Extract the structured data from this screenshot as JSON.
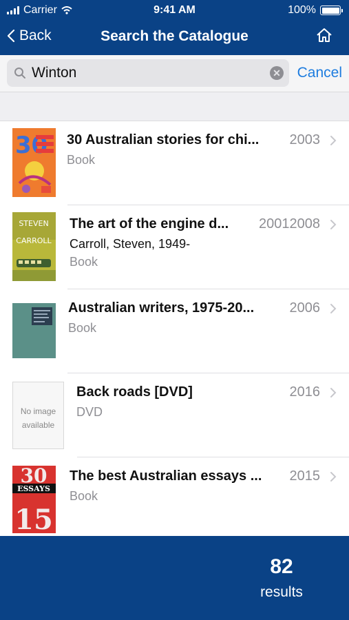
{
  "status_bar": {
    "carrier": "Carrier",
    "time": "9:41 AM",
    "battery": "100%",
    "battery_level": 1.0
  },
  "nav": {
    "back_label": "Back",
    "title": "Search the Catalogue",
    "home_icon": "home-icon"
  },
  "search": {
    "value": "Winton",
    "cancel_label": "Cancel"
  },
  "results": [
    {
      "title": "30 Australian stories for chi...",
      "year": "2003",
      "author": "",
      "type": "Book",
      "cover": "cover-30-stories"
    },
    {
      "title": "The art of the engine d...",
      "year": "20012008",
      "author": "Carroll, Steven, 1949-",
      "type": "Book",
      "cover": "cover-steven-carroll",
      "cover_text_top": "STEVEN",
      "cover_text_mid": "CARROLL"
    },
    {
      "title": "Australian writers, 1975-20...",
      "year": "2006",
      "author": "",
      "type": "Book",
      "cover": "cover-dictionary"
    },
    {
      "title": "Back roads [DVD]",
      "year": "2016",
      "author": "",
      "type": "DVD",
      "cover": "no-image",
      "cover_text_1": "No image",
      "cover_text_2": "available"
    },
    {
      "title": "The best Australian essays ...",
      "year": "2015",
      "author": "",
      "type": "Book",
      "cover": "cover-essays",
      "cover_text": "ESSAYS"
    }
  ],
  "footer": {
    "count": "82",
    "count_label": "results"
  },
  "colors": {
    "brand_blue": "#0a4286",
    "link_blue": "#1d7cdf",
    "secondary_text": "#8e8e93"
  }
}
